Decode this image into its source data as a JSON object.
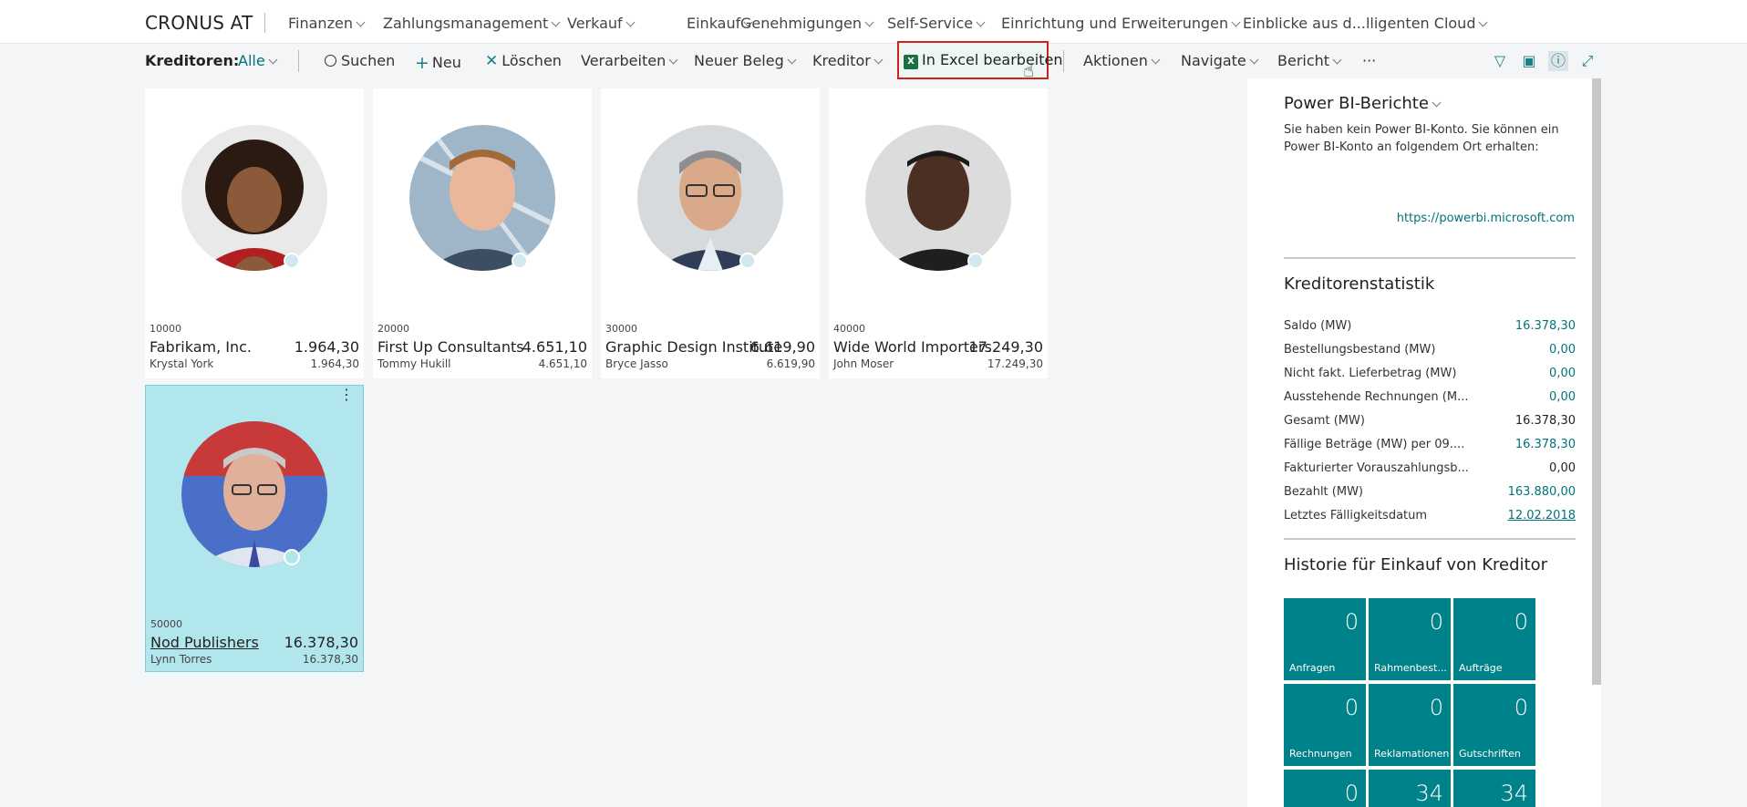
{
  "app": {
    "brand": "CRONUS AT"
  },
  "nav": [
    "Finanzen",
    "Zahlungsmanagement",
    "Verkauf",
    "Einkauf",
    "Genehmigungen",
    "Self-Service",
    "Einrichtung und Erweiterungen",
    "Einblicke aus d...lligenten Cloud"
  ],
  "actions": {
    "page_label": "Kreditoren:",
    "filter": "Alle",
    "search": "Suchen",
    "new": "Neu",
    "delete": "Löschen",
    "process": "Verarbeiten",
    "new_doc": "Neuer Beleg",
    "vendor": "Kreditor",
    "excel": "In Excel bearbeiten",
    "excel_icon": "X",
    "actions": "Aktionen",
    "navigate": "Navigate",
    "report": "Bericht",
    "more": "···",
    "icons": {
      "filter": "▽",
      "layout": "▣",
      "info": "ⓘ",
      "expand": "⤢"
    }
  },
  "vendors": [
    {
      "no": "10000",
      "name": "Fabrikam, Inc.",
      "balance": "1.964,30",
      "contact": "Krystal York",
      "balance2": "1.964,30"
    },
    {
      "no": "20000",
      "name": "First Up Consultants",
      "balance": "4.651,10",
      "contact": "Tommy Hukill",
      "balance2": "4.651,10"
    },
    {
      "no": "30000",
      "name": "Graphic Design Institute",
      "balance": "6.619,90",
      "contact": "Bryce Jasso",
      "balance2": "6.619,90"
    },
    {
      "no": "40000",
      "name": "Wide World Importers",
      "balance": "17.249,30",
      "contact": "John Moser",
      "balance2": "17.249,30"
    },
    {
      "no": "50000",
      "name": "Nod Publishers",
      "balance": "16.378,30",
      "contact": "Lynn Torres",
      "balance2": "16.378,30"
    }
  ],
  "factbox": {
    "powerbi_title": "Power BI-Berichte",
    "powerbi_text": "Sie haben kein Power BI-Konto. Sie können ein Power BI-Konto an folgendem Ort erhalten:",
    "powerbi_link": "https://powerbi.microsoft.com",
    "stats_title": "Kreditorenstatistik",
    "stats": [
      {
        "label": "Saldo (MW)",
        "value": "16.378,30"
      },
      {
        "label": "Bestellungsbestand (MW)",
        "value": "0,00"
      },
      {
        "label": "Nicht fakt. Lieferbetrag (MW)",
        "value": "0,00"
      },
      {
        "label": "Ausstehende Rechnungen (M...",
        "value": "0,00"
      },
      {
        "label": "Gesamt (MW)",
        "value": "16.378,30"
      },
      {
        "label": "Fällige Beträge (MW) per 09....",
        "value": "16.378,30"
      },
      {
        "label": "Fakturierter Vorauszahlungsb...",
        "value": "0,00"
      },
      {
        "label": "Bezahlt (MW)",
        "value": "163.880,00"
      },
      {
        "label": "Letztes Fälligkeitsdatum",
        "value": "12.02.2018"
      }
    ],
    "history_title": "Historie für Einkauf von Kreditor",
    "tiles": [
      {
        "num": "0",
        "label": "Anfragen"
      },
      {
        "num": "0",
        "label": "Rahmenbest..."
      },
      {
        "num": "0",
        "label": "Aufträge"
      },
      {
        "num": "0",
        "label": "Rechnungen"
      },
      {
        "num": "0",
        "label": "Reklamationen"
      },
      {
        "num": "0",
        "label": "Gutschriften"
      },
      {
        "num": "0",
        "label": ""
      },
      {
        "num": "34",
        "label": ""
      },
      {
        "num": "34",
        "label": ""
      }
    ]
  }
}
